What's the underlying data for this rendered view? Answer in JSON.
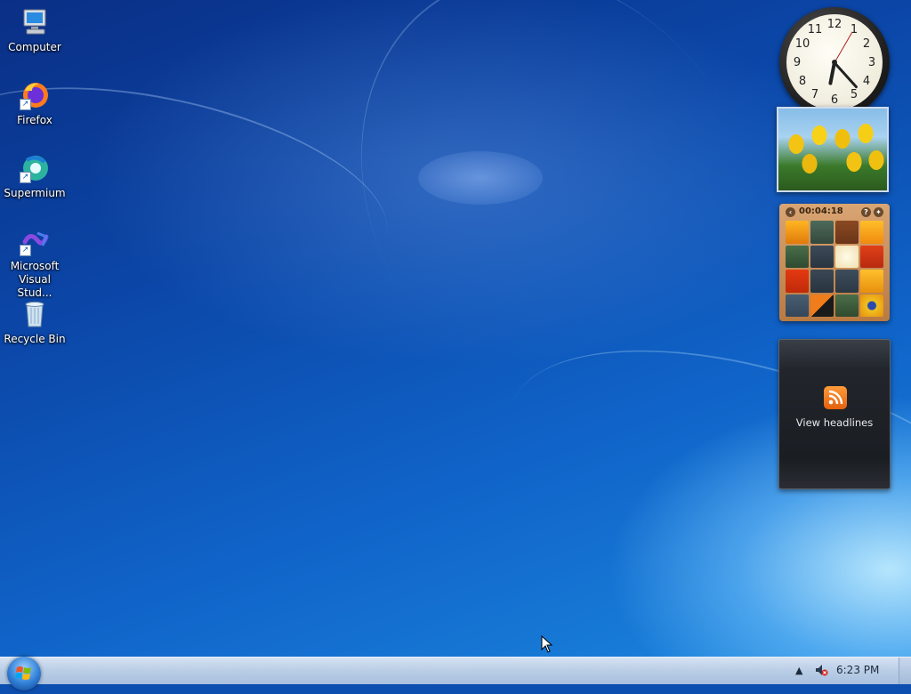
{
  "desktop": {
    "icons": [
      {
        "label": "Computer"
      },
      {
        "label": "Firefox"
      },
      {
        "label": "Supermium"
      },
      {
        "label": "Microsoft Visual Stud..."
      },
      {
        "label": "Recycle Bin"
      }
    ]
  },
  "gadgets": {
    "clock": {
      "numbers": [
        "12",
        "1",
        "2",
        "3",
        "4",
        "5",
        "6",
        "7",
        "8",
        "9",
        "10",
        "11"
      ]
    },
    "puzzle": {
      "timer": "00:04:18"
    },
    "feed": {
      "label": "View headlines"
    }
  },
  "taskbar": {
    "time": "6:23 PM"
  },
  "colors": {
    "taskbar": "#b9cde6",
    "feed_orange": "#ff8a2a"
  }
}
